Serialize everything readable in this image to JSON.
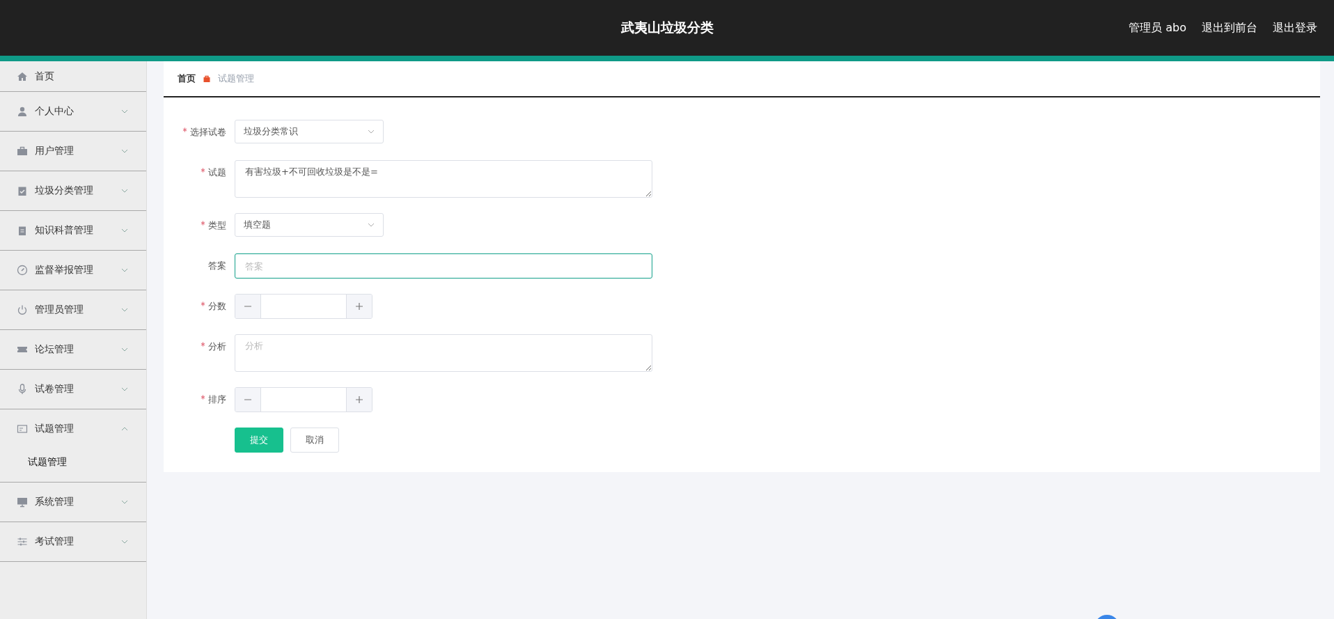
{
  "header": {
    "title": "武夷山垃圾分类",
    "links": [
      "管理员 abo",
      "退出到前台",
      "退出登录"
    ]
  },
  "sidebar": {
    "items": [
      {
        "label": "首页"
      },
      {
        "label": "个人中心",
        "expanded": false
      },
      {
        "label": "用户管理",
        "expanded": false
      },
      {
        "label": "垃圾分类管理",
        "expanded": false
      },
      {
        "label": "知识科普管理",
        "expanded": false
      },
      {
        "label": "监督举报管理",
        "expanded": false
      },
      {
        "label": "管理员管理",
        "expanded": false
      },
      {
        "label": "论坛管理",
        "expanded": false
      },
      {
        "label": "试卷管理",
        "expanded": false
      },
      {
        "label": "试题管理",
        "expanded": true,
        "children": [
          {
            "label": "试题管理"
          }
        ]
      },
      {
        "label": "系统管理",
        "expanded": false
      },
      {
        "label": "考试管理",
        "expanded": false
      }
    ]
  },
  "breadcrumb": [
    "首页",
    "试题管理"
  ],
  "form": {
    "fields": [
      {
        "kind": "select",
        "label": "选择试卷",
        "required": true,
        "value": "垃圾分类常识"
      },
      {
        "kind": "textarea",
        "label": "试题",
        "required": true,
        "value": "有害垃圾+不可回收垃圾是不是="
      },
      {
        "kind": "select",
        "label": "类型",
        "required": true,
        "value": "填空题"
      },
      {
        "kind": "input",
        "label": "答案",
        "required": false,
        "placeholder": "答案",
        "focused": true
      },
      {
        "kind": "number",
        "label": "分数",
        "required": true
      },
      {
        "kind": "textarea",
        "label": "分析",
        "required": true,
        "placeholder": "分析"
      },
      {
        "kind": "number",
        "label": "排序",
        "required": true
      }
    ],
    "buttons": [
      {
        "label": "提交",
        "kind": "primary"
      },
      {
        "label": "取消",
        "kind": "default"
      }
    ]
  }
}
